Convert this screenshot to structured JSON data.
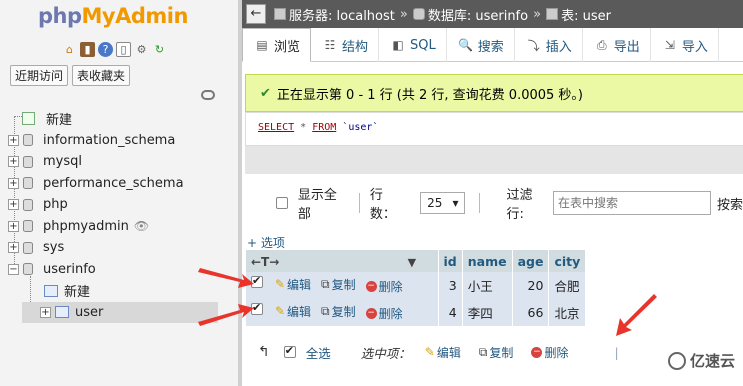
{
  "app": {
    "logo_part1": "php",
    "logo_part2": "MyAdmin"
  },
  "nav": {
    "tabs": [
      "近期访问",
      "表收藏夹"
    ],
    "tree": [
      {
        "label": "新建",
        "type": "new"
      },
      {
        "label": "information_schema",
        "type": "db"
      },
      {
        "label": "mysql",
        "type": "db"
      },
      {
        "label": "performance_schema",
        "type": "db"
      },
      {
        "label": "php",
        "type": "db"
      },
      {
        "label": "phpmyadmin",
        "type": "db"
      },
      {
        "label": "sys",
        "type": "db"
      },
      {
        "label": "userinfo",
        "type": "db-open"
      }
    ],
    "sub": [
      {
        "label": "新建"
      },
      {
        "label": "user"
      }
    ]
  },
  "breadcrumb": {
    "server": "服务器: localhost",
    "database": "数据库: userinfo",
    "table": "表: user"
  },
  "tabs": [
    {
      "label": "浏览",
      "icon": "browse-icon",
      "glyph": "▤"
    },
    {
      "label": "结构",
      "icon": "structure-icon",
      "glyph": "☷"
    },
    {
      "label": "SQL",
      "icon": "sql-icon",
      "glyph": "◧"
    },
    {
      "label": "搜索",
      "icon": "search-icon",
      "glyph": "🔍"
    },
    {
      "label": "插入",
      "icon": "insert-icon",
      "glyph": "⤵"
    },
    {
      "label": "导出",
      "icon": "export-icon",
      "glyph": "⎙"
    },
    {
      "label": "导入",
      "icon": "import-icon",
      "glyph": "⇲"
    }
  ],
  "message": "正在显示第 0 - 1 行 (共 2 行, 查询花费 0.0005 秒。)",
  "sql": {
    "kw1": "SELECT",
    "rest1": " * ",
    "kw2": "FROM",
    "table": " `user`"
  },
  "controls": {
    "show_all": "显示全部",
    "rows_label": "行数：",
    "rows_value": "25",
    "filter_label": "过滤行:",
    "filter_placeholder": "在表中搜索",
    "sort_label": "按索"
  },
  "options_link": "+ 选项",
  "table": {
    "columns": [
      "id",
      "name",
      "age",
      "city"
    ],
    "row_actions": {
      "edit": "编辑",
      "copy": "复制",
      "delete": "删除"
    },
    "rows": [
      {
        "id": "3",
        "name": "小王",
        "age": "20",
        "city": "合肥"
      },
      {
        "id": "4",
        "name": "李四",
        "age": "66",
        "city": "北京"
      }
    ]
  },
  "bottom": {
    "select_all": "全选",
    "with_selected": "选中项：",
    "edit": "编辑",
    "copy": "复制",
    "delete": "删除"
  },
  "watermark": "亿速云",
  "colors": {
    "accent": "#235a81",
    "success_bg": "#ebf8a4",
    "annotation": "#e8342a"
  }
}
